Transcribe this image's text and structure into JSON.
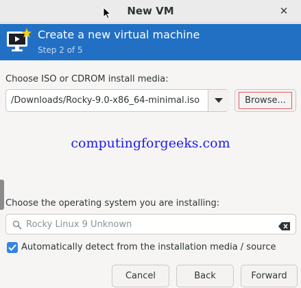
{
  "window": {
    "title": "New VM",
    "close_icon": "close-icon"
  },
  "header": {
    "title": "Create a new virtual machine",
    "step": "Step 2 of 5",
    "icon": "new-vm-icon",
    "background_color": "#2270c4"
  },
  "install_media": {
    "label": "Choose ISO or CDROM install media:",
    "selected_value": "/Downloads/Rocky-9.0-x86_64-minimal.iso",
    "dropdown_icon": "chevron-down-icon",
    "browse_label": "Browse..."
  },
  "watermark": {
    "text": "computingforgeeks.com",
    "color": "#1a1aee"
  },
  "os_selection": {
    "label": "Choose the operating system you are installing:",
    "search_value": "Rocky Linux 9 Unknown",
    "search_icon": "search-icon",
    "clear_icon": "clear-icon",
    "auto_detect_label": "Automatically detect from the installation media / source",
    "auto_detect_checked": true
  },
  "footer": {
    "cancel_label": "Cancel",
    "back_label": "Back",
    "forward_label": "Forward"
  }
}
